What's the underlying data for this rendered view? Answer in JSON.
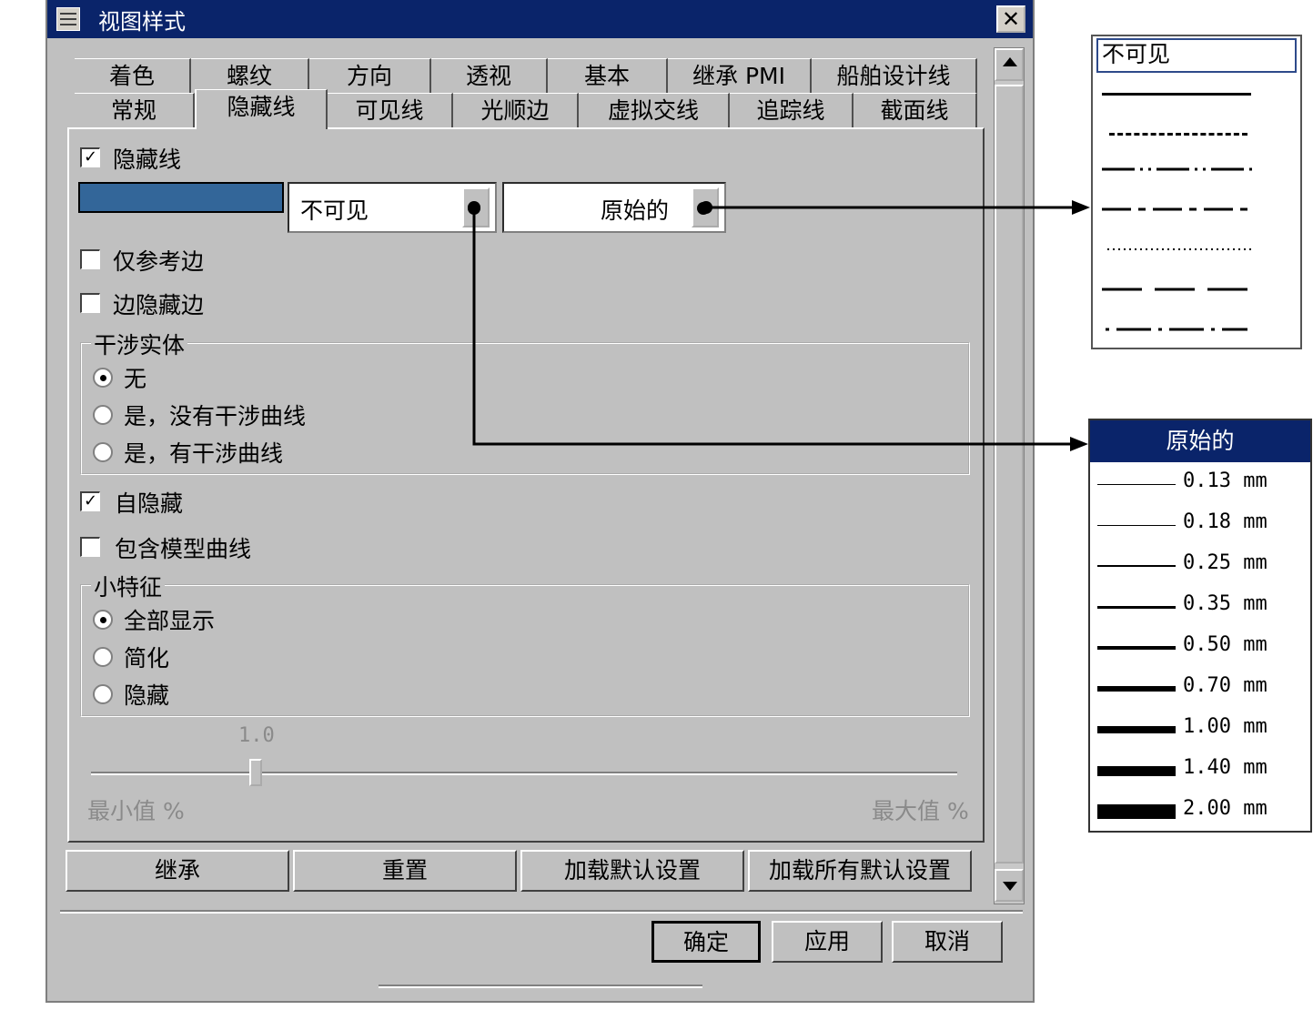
{
  "window": {
    "title": "视图样式",
    "close": "✕"
  },
  "tabs_row1": [
    "着色",
    "螺纹",
    "方向",
    "透视",
    "基本",
    "继承 PMI",
    "船舶设计线"
  ],
  "tabs_row2": [
    "常规",
    "隐藏线",
    "可见线",
    "光顺边",
    "虚拟交线",
    "追踪线",
    "截面线"
  ],
  "active_tab": "隐藏线",
  "hidden_line": {
    "checkbox_label": "隐藏线",
    "checked": true,
    "color": "#336699",
    "line_type": "不可见",
    "line_width": "原始的"
  },
  "options": {
    "ref_edges_only": "仅参考边",
    "edge_hidden_by_edge": "边隐藏边",
    "self_hidden": "自隐藏",
    "include_model_curves": "包含模型曲线"
  },
  "interference": {
    "title": "干涉实体",
    "opts": [
      "无",
      "是，没有干涉曲线",
      "是，有干涉曲线"
    ],
    "selected": 0
  },
  "small_features": {
    "title": "小特征",
    "opts": [
      "全部显示",
      "简化",
      "隐藏"
    ],
    "selected": 0
  },
  "slider": {
    "value": "1.0",
    "min_label": "最小值 %",
    "max_label": "最大值 %",
    "position": 0.19
  },
  "action_buttons": [
    "继承",
    "重置",
    "加载默认设置",
    "加载所有默认设置"
  ],
  "footer_buttons": {
    "ok": "确定",
    "apply": "应用",
    "cancel": "取消"
  },
  "line_type_popup": {
    "selected": "不可见",
    "styles": [
      "solid",
      "dashed",
      "long-dash-double-dot",
      "long-dash-dot",
      "dotted",
      "long-dash",
      "dash-dot"
    ]
  },
  "line_width_popup": {
    "header": "原始的",
    "items": [
      "0.13 mm",
      "0.18 mm",
      "0.25 mm",
      "0.35 mm",
      "0.50 mm",
      "0.70 mm",
      "1.00 mm",
      "1.40 mm",
      "2.00 mm"
    ],
    "widths_mm": [
      0.13,
      0.18,
      0.25,
      0.35,
      0.5,
      0.7,
      1.0,
      1.4,
      2.0
    ]
  },
  "colors": {
    "title_bar": "#0a246a",
    "dialog": "#c0c0c0",
    "popup_header": "#0a246a"
  }
}
